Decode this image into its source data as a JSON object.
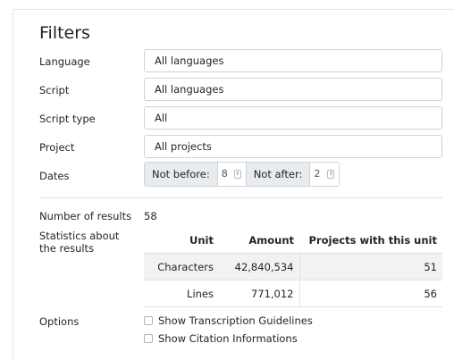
{
  "filters": {
    "title": "Filters",
    "language": {
      "label": "Language",
      "value": "All languages"
    },
    "script": {
      "label": "Script",
      "value": "All languages"
    },
    "script_type": {
      "label": "Script type",
      "value": "All"
    },
    "project": {
      "label": "Project",
      "value": "All projects"
    },
    "dates": {
      "label": "Dates",
      "not_before_label": "Not before:",
      "not_before_value": "8",
      "not_after_label": "Not after:",
      "not_after_value": "2"
    }
  },
  "results": {
    "count_label": "Number of results",
    "count_value": "58",
    "stats_label_line1": "Statistics about",
    "stats_label_line2": "the results",
    "table": {
      "headers": [
        "Unit",
        "Amount",
        "Projects with this unit"
      ],
      "rows": [
        [
          "Characters",
          "42,840,534",
          "51"
        ],
        [
          "Lines",
          "771,012",
          "56"
        ]
      ]
    }
  },
  "options": {
    "label": "Options",
    "checkboxes": [
      {
        "label": "Show Transcription Guidelines",
        "checked": false
      },
      {
        "label": "Show Citation Informations",
        "checked": false
      }
    ]
  }
}
